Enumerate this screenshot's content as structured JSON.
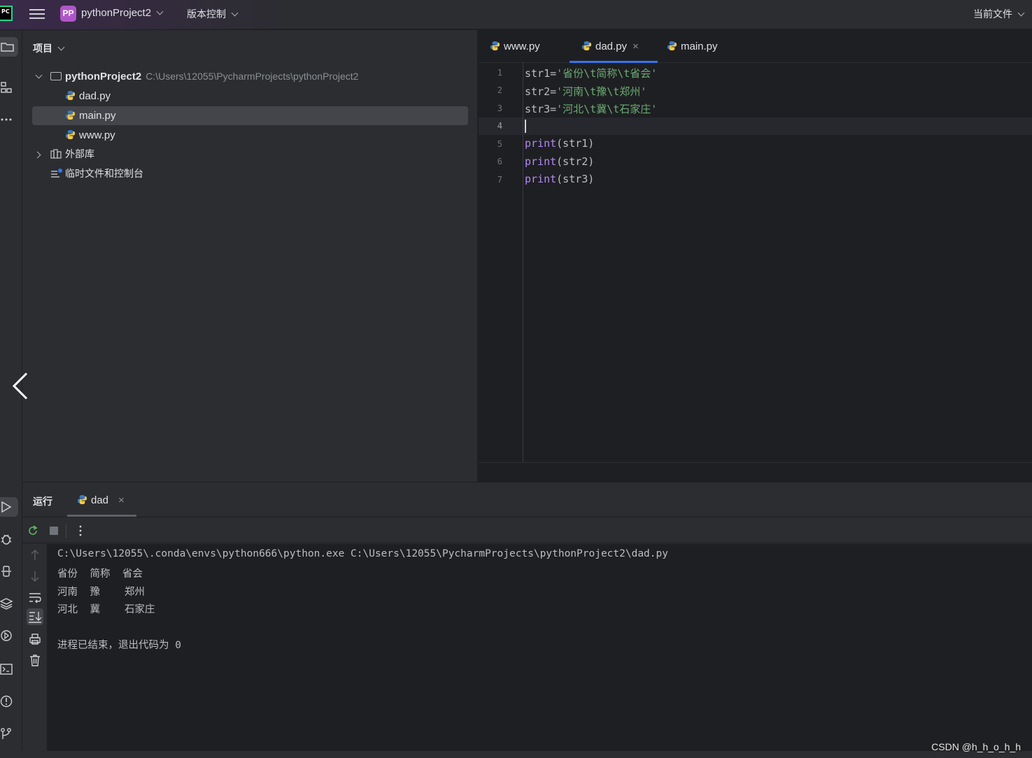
{
  "titlebar": {
    "project_badge": "PP",
    "project_name": "pythonProject2",
    "vcs_label": "版本控制",
    "current_file_label": "当前文件"
  },
  "project_panel": {
    "header": "项目",
    "root": {
      "name": "pythonProject2",
      "path": "C:\\Users\\12055\\PycharmProjects\\pythonProject2"
    },
    "files": [
      "dad.py",
      "main.py",
      "www.py"
    ],
    "selected": "main.py",
    "external_libs": "外部库",
    "scratches": "临时文件和控制台"
  },
  "editor": {
    "tabs": [
      {
        "label": "www.py",
        "active": false
      },
      {
        "label": "dad.py",
        "active": true,
        "close": "×"
      },
      {
        "label": "main.py",
        "active": false
      }
    ],
    "line_numbers": [
      "1",
      "2",
      "3",
      "4",
      "5",
      "6",
      "7"
    ],
    "current_line": 4,
    "lines": {
      "l1": {
        "var": "str1=",
        "str": "'省份\\t简称\\t省会'"
      },
      "l2": {
        "var": "str2=",
        "str": "'河南\\t豫\\t郑州'"
      },
      "l3": {
        "var": "str3=",
        "str": "'河北\\t冀\\t石家庄'"
      },
      "l5": {
        "fn": "print",
        "args": "(str1)"
      },
      "l6": {
        "fn": "print",
        "args": "(str2)"
      },
      "l7": {
        "fn": "print",
        "args": "(str3)"
      }
    }
  },
  "run_panel": {
    "title": "运行",
    "tab_label": "dad",
    "tab_close": "×",
    "console": {
      "command": "C:\\Users\\12055\\.conda\\envs\\python666\\python.exe C:\\Users\\12055\\PycharmProjects\\pythonProject2\\dad.py",
      "out1": "省份  简称  省会",
      "out2": "河南  豫    郑州",
      "out3": "河北  冀    石家庄",
      "exit": "进程已结束，退出代码为 0"
    }
  },
  "watermark": "CSDN @h_h_o_h_h",
  "colors": {
    "background": "#1e1f22",
    "panel": "#2b2d30",
    "accent": "#3574f0",
    "string": "#6aab73",
    "builtin": "#b189f5",
    "project_badge": "#b056c8"
  }
}
